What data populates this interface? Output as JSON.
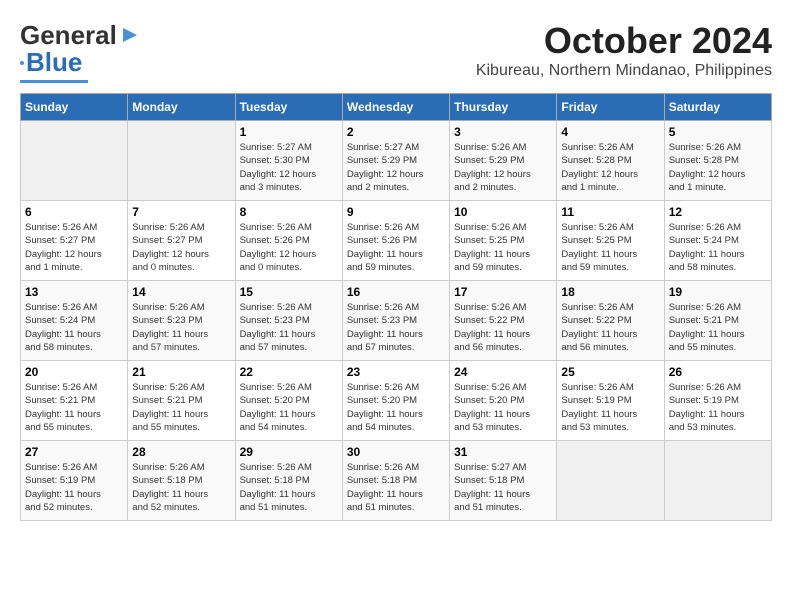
{
  "logo": {
    "part1": "General",
    "part2": "Blue"
  },
  "header": {
    "month": "October 2024",
    "location": "Kibureau, Northern Mindanao, Philippines"
  },
  "days_of_week": [
    "Sunday",
    "Monday",
    "Tuesday",
    "Wednesday",
    "Thursday",
    "Friday",
    "Saturday"
  ],
  "weeks": [
    [
      {
        "day": "",
        "info": ""
      },
      {
        "day": "",
        "info": ""
      },
      {
        "day": "1",
        "info": "Sunrise: 5:27 AM\nSunset: 5:30 PM\nDaylight: 12 hours\nand 3 minutes."
      },
      {
        "day": "2",
        "info": "Sunrise: 5:27 AM\nSunset: 5:29 PM\nDaylight: 12 hours\nand 2 minutes."
      },
      {
        "day": "3",
        "info": "Sunrise: 5:26 AM\nSunset: 5:29 PM\nDaylight: 12 hours\nand 2 minutes."
      },
      {
        "day": "4",
        "info": "Sunrise: 5:26 AM\nSunset: 5:28 PM\nDaylight: 12 hours\nand 1 minute."
      },
      {
        "day": "5",
        "info": "Sunrise: 5:26 AM\nSunset: 5:28 PM\nDaylight: 12 hours\nand 1 minute."
      }
    ],
    [
      {
        "day": "6",
        "info": "Sunrise: 5:26 AM\nSunset: 5:27 PM\nDaylight: 12 hours\nand 1 minute."
      },
      {
        "day": "7",
        "info": "Sunrise: 5:26 AM\nSunset: 5:27 PM\nDaylight: 12 hours\nand 0 minutes."
      },
      {
        "day": "8",
        "info": "Sunrise: 5:26 AM\nSunset: 5:26 PM\nDaylight: 12 hours\nand 0 minutes."
      },
      {
        "day": "9",
        "info": "Sunrise: 5:26 AM\nSunset: 5:26 PM\nDaylight: 11 hours\nand 59 minutes."
      },
      {
        "day": "10",
        "info": "Sunrise: 5:26 AM\nSunset: 5:25 PM\nDaylight: 11 hours\nand 59 minutes."
      },
      {
        "day": "11",
        "info": "Sunrise: 5:26 AM\nSunset: 5:25 PM\nDaylight: 11 hours\nand 59 minutes."
      },
      {
        "day": "12",
        "info": "Sunrise: 5:26 AM\nSunset: 5:24 PM\nDaylight: 11 hours\nand 58 minutes."
      }
    ],
    [
      {
        "day": "13",
        "info": "Sunrise: 5:26 AM\nSunset: 5:24 PM\nDaylight: 11 hours\nand 58 minutes."
      },
      {
        "day": "14",
        "info": "Sunrise: 5:26 AM\nSunset: 5:23 PM\nDaylight: 11 hours\nand 57 minutes."
      },
      {
        "day": "15",
        "info": "Sunrise: 5:26 AM\nSunset: 5:23 PM\nDaylight: 11 hours\nand 57 minutes."
      },
      {
        "day": "16",
        "info": "Sunrise: 5:26 AM\nSunset: 5:23 PM\nDaylight: 11 hours\nand 57 minutes."
      },
      {
        "day": "17",
        "info": "Sunrise: 5:26 AM\nSunset: 5:22 PM\nDaylight: 11 hours\nand 56 minutes."
      },
      {
        "day": "18",
        "info": "Sunrise: 5:26 AM\nSunset: 5:22 PM\nDaylight: 11 hours\nand 56 minutes."
      },
      {
        "day": "19",
        "info": "Sunrise: 5:26 AM\nSunset: 5:21 PM\nDaylight: 11 hours\nand 55 minutes."
      }
    ],
    [
      {
        "day": "20",
        "info": "Sunrise: 5:26 AM\nSunset: 5:21 PM\nDaylight: 11 hours\nand 55 minutes."
      },
      {
        "day": "21",
        "info": "Sunrise: 5:26 AM\nSunset: 5:21 PM\nDaylight: 11 hours\nand 55 minutes."
      },
      {
        "day": "22",
        "info": "Sunrise: 5:26 AM\nSunset: 5:20 PM\nDaylight: 11 hours\nand 54 minutes."
      },
      {
        "day": "23",
        "info": "Sunrise: 5:26 AM\nSunset: 5:20 PM\nDaylight: 11 hours\nand 54 minutes."
      },
      {
        "day": "24",
        "info": "Sunrise: 5:26 AM\nSunset: 5:20 PM\nDaylight: 11 hours\nand 53 minutes."
      },
      {
        "day": "25",
        "info": "Sunrise: 5:26 AM\nSunset: 5:19 PM\nDaylight: 11 hours\nand 53 minutes."
      },
      {
        "day": "26",
        "info": "Sunrise: 5:26 AM\nSunset: 5:19 PM\nDaylight: 11 hours\nand 53 minutes."
      }
    ],
    [
      {
        "day": "27",
        "info": "Sunrise: 5:26 AM\nSunset: 5:19 PM\nDaylight: 11 hours\nand 52 minutes."
      },
      {
        "day": "28",
        "info": "Sunrise: 5:26 AM\nSunset: 5:18 PM\nDaylight: 11 hours\nand 52 minutes."
      },
      {
        "day": "29",
        "info": "Sunrise: 5:26 AM\nSunset: 5:18 PM\nDaylight: 11 hours\nand 51 minutes."
      },
      {
        "day": "30",
        "info": "Sunrise: 5:26 AM\nSunset: 5:18 PM\nDaylight: 11 hours\nand 51 minutes."
      },
      {
        "day": "31",
        "info": "Sunrise: 5:27 AM\nSunset: 5:18 PM\nDaylight: 11 hours\nand 51 minutes."
      },
      {
        "day": "",
        "info": ""
      },
      {
        "day": "",
        "info": ""
      }
    ]
  ]
}
